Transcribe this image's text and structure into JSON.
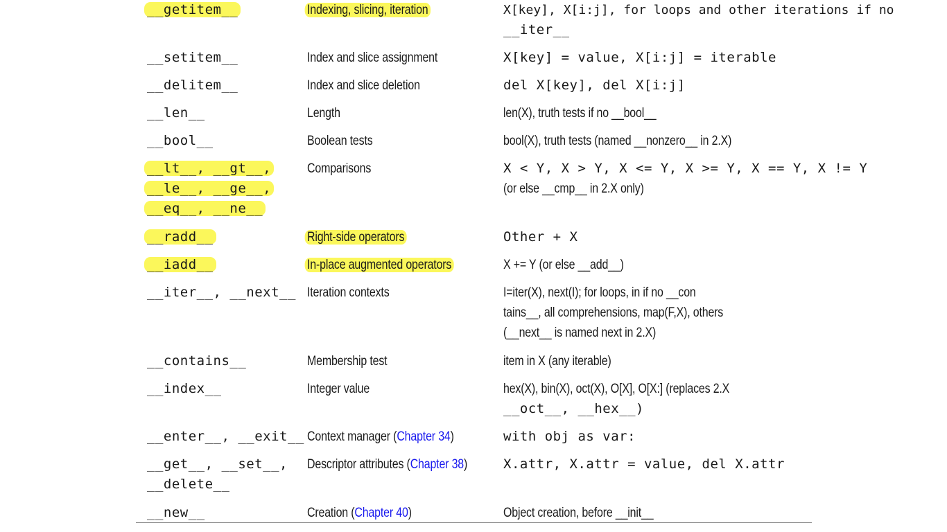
{
  "rows": [
    {
      "m": [
        "__getitem__"
      ],
      "d": "Indexing, slicing, iteration",
      "u": [
        "X[key], X[i:j], for loops and other iterations if no",
        "__iter__"
      ]
    },
    {
      "m": [
        "__setitem__"
      ],
      "d": "Index and slice assignment",
      "u": [
        "X[key] = value, X[i:j] = iterable"
      ]
    },
    {
      "m": [
        "__delitem__"
      ],
      "d": "Index and slice deletion",
      "u": [
        "del X[key], del X[i:j]"
      ]
    },
    {
      "m": [
        "__len__"
      ],
      "d": "Length",
      "u": [
        "len(X), truth tests if no __bool__"
      ]
    },
    {
      "m": [
        "__bool__"
      ],
      "d": "Boolean tests",
      "u": [
        "bool(X), truth tests (named __nonzero__ in 2.X)"
      ]
    },
    {
      "m": [
        "__lt__, __gt__,",
        "__le__, __ge__,",
        "__eq__, __ne__"
      ],
      "d": "Comparisons",
      "u": [
        "X < Y, X > Y, X <= Y, X >= Y, X == Y, X != Y",
        "(or else __cmp__ in 2.X only)"
      ]
    },
    {
      "m": [
        "__radd__"
      ],
      "d": "Right-side operators",
      "u": [
        "Other + X"
      ]
    },
    {
      "m": [
        "__iadd__"
      ],
      "d": "In-place augmented operators",
      "u": [
        "X += Y (or else __add__)"
      ]
    },
    {
      "m": [
        "__iter__, __next__"
      ],
      "d": "Iteration contexts",
      "u": [
        "I=iter(X), next(I); for loops, in if no __con",
        "tains__, all comprehensions, map(F,X), others",
        "(__next__ is named next in 2.X)"
      ]
    },
    {
      "m": [
        "__contains__"
      ],
      "d": "Membership test",
      "u": [
        "item in X (any iterable)"
      ]
    },
    {
      "m": [
        "__index__"
      ],
      "d": "Integer value",
      "u": [
        "hex(X), bin(X), oct(X), O[X], O[X:] (replaces 2.X",
        "__oct__, __hex__)"
      ]
    },
    {
      "m": [
        "__enter__, __exit__"
      ],
      "d": "Context manager (",
      "link": "Chapter 34",
      "d2": ")",
      "u": [
        "with obj as var:"
      ]
    },
    {
      "m": [
        "__get__, __set__,",
        "__delete__"
      ],
      "d": "Descriptor attributes (",
      "link": "Chapter 38",
      "d2": ")",
      "u": [
        "X.attr, X.attr = value, del X.attr"
      ]
    },
    {
      "m": [
        "__new__"
      ],
      "d": "Creation (",
      "link": "Chapter 40",
      "d2": ")",
      "u": [
        "Object creation, before __init__"
      ]
    }
  ]
}
